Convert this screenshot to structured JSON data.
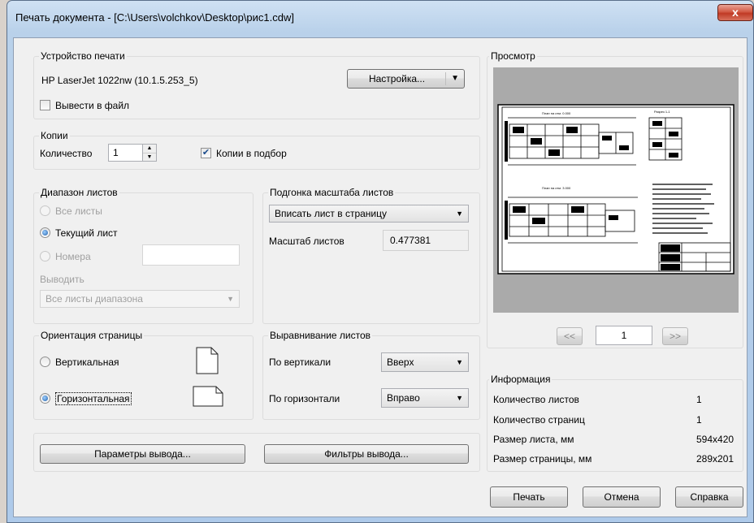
{
  "window": {
    "title": "Печать документа - [C:\\Users\\volchkov\\Desktop\\рис1.cdw]",
    "close_label": "x"
  },
  "printer": {
    "legend": "Устройство печати",
    "name": "HP LaserJet 1022nw (10.1.5.253_5)",
    "setup_label": "Настройка...",
    "print_to_file_label": "Вывести в файл",
    "print_to_file_checked": false
  },
  "copies": {
    "legend": "Копии",
    "count_label": "Количество",
    "count_value": "1",
    "collate_label": "Копии в подбор",
    "collate_checked": true
  },
  "range": {
    "legend": "Диапазон листов",
    "all_label": "Все листы",
    "current_label": "Текущий лист",
    "numbers_label": "Номера",
    "numbers_value": "",
    "output_label": "Выводить",
    "output_value": "Все листы диапазона"
  },
  "scale": {
    "legend": "Подгонка масштаба листов",
    "mode_value": "Вписать лист в страницу",
    "scale_label": "Масштаб листов",
    "scale_value": "0.477381"
  },
  "orientation": {
    "legend": "Ориентация страницы",
    "portrait_label": "Вертикальная",
    "landscape_label": "Горизонтальная"
  },
  "align": {
    "legend": "Выравнивание листов",
    "vertical_label": "По вертикали",
    "vertical_value": "Вверх",
    "horizontal_label": "По горизонтали",
    "horizontal_value": "Вправо"
  },
  "buttons": {
    "output_params": "Параметры вывода...",
    "output_filters": "Фильтры вывода...",
    "print": "Печать",
    "cancel": "Отмена",
    "help": "Справка"
  },
  "preview": {
    "legend": "Просмотр",
    "prev_label": "<<",
    "page_value": "1",
    "next_label": ">>",
    "plan_title_1": "План на отм. 0.000",
    "section_title": "Разрез 1-1",
    "plan_title_2": "План на отм. 3.000",
    "icon": "drawing-thumbnail-icon"
  },
  "info": {
    "legend": "Информация",
    "rows": [
      {
        "label": "Количество листов",
        "value": "1"
      },
      {
        "label": "Количество страниц",
        "value": "1"
      },
      {
        "label": "Размер листа, мм",
        "value": "594x420"
      },
      {
        "label": "Размер страницы, мм",
        "value": "289x201"
      }
    ]
  }
}
